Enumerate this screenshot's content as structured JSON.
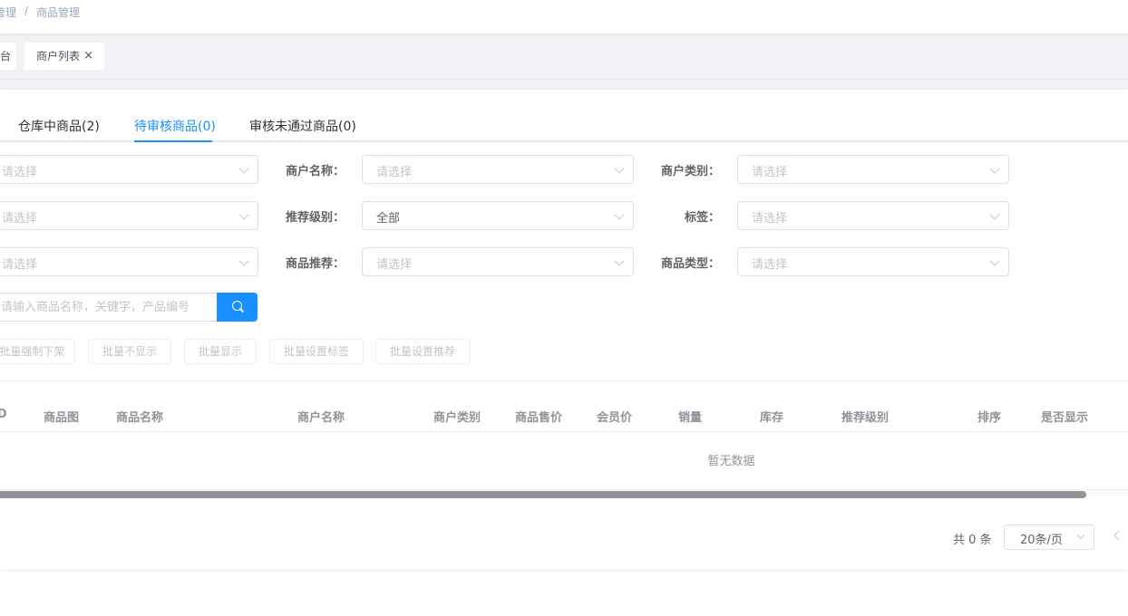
{
  "breadcrumb": {
    "first": "管理",
    "separator": "/",
    "current": "商品管理"
  },
  "tags": [
    {
      "label": "台"
    },
    {
      "label": "商户列表",
      "close": "×"
    }
  ],
  "tabs": [
    {
      "label": "仓库中商品(2)"
    },
    {
      "label": "待审核商品(0)",
      "active": true
    },
    {
      "label": "审核未通过商品(0)"
    }
  ],
  "filters": {
    "row1": {
      "a_value": "请选择",
      "b_label": "商户名称：",
      "b_value": "请选择",
      "c_label": "商户类别：",
      "c_value": "请选择"
    },
    "row2": {
      "a_value": "请选择",
      "b_label": "推荐级别：",
      "b_value": "全部",
      "c_label": "标签：",
      "c_value": "请选择"
    },
    "row3": {
      "a_value": "请选择",
      "b_label": "商品推荐：",
      "b_value": "请选择",
      "c_label": "商品类型：",
      "c_value": "请选择"
    }
  },
  "search": {
    "placeholder": "请输入商品名称，关键字，产品编号",
    "icon": "search-icon"
  },
  "batch_buttons": [
    "批量强制下架",
    "批量不显示",
    "批量显示",
    "批量设置标签",
    "批量设置推荐"
  ],
  "table": {
    "columns": [
      "ID",
      "商品图",
      "商品名称",
      "商户名称",
      "商户类别",
      "商品售价",
      "会员价",
      "销量",
      "库存",
      "推荐级别",
      "排序",
      "是否显示"
    ],
    "empty_text": "暂无数据"
  },
  "pagination": {
    "total": "共 0 条",
    "page_size": "20条/页"
  },
  "colors": {
    "accent": "#1890ff",
    "border": "#dcdfe6",
    "placeholder": "#c0c4cc",
    "page_bg": "#f0f2f5"
  }
}
